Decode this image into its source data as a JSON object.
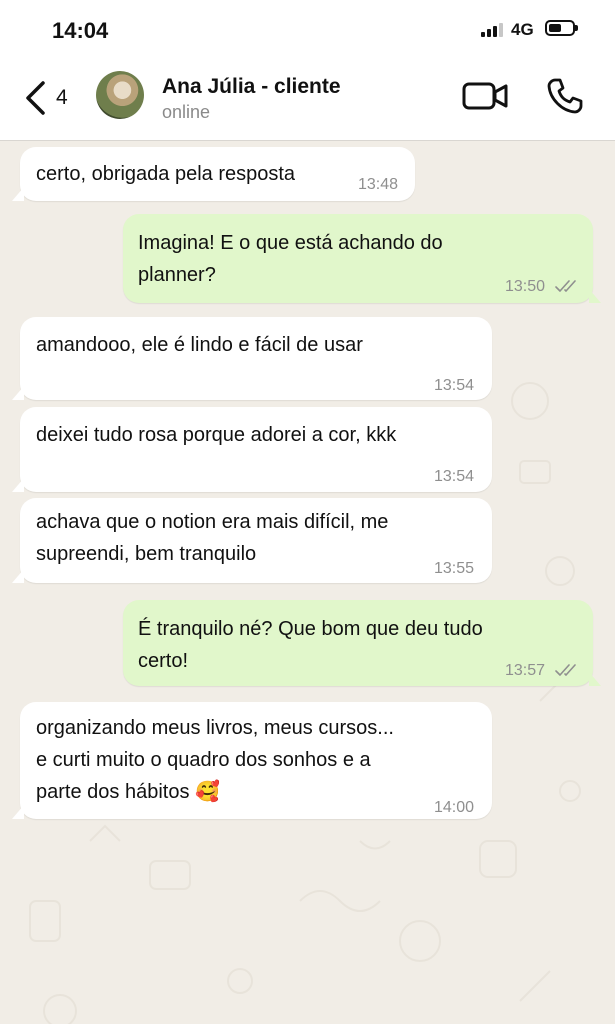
{
  "status_bar": {
    "time": "14:04",
    "network": "4G"
  },
  "header": {
    "back_count": "4",
    "contact_name": "Ana Júlia - cliente",
    "contact_status": "online"
  },
  "messages": [
    {
      "dir": "in",
      "text": "certo, obrigada pela resposta",
      "time": "13:48"
    },
    {
      "dir": "out",
      "text": "Imagina! E o que está achando do\nplanner?",
      "time": "13:50",
      "read": true
    },
    {
      "dir": "in",
      "text": "amandooo, ele é lindo e fácil de usar",
      "time": "13:54"
    },
    {
      "dir": "in",
      "text": "deixei tudo rosa porque adorei a cor, kkk",
      "time": "13:54"
    },
    {
      "dir": "in",
      "text": "achava que o notion era mais difícil, me\nsupreendi, bem tranquilo",
      "time": "13:55"
    },
    {
      "dir": "out",
      "text": "É tranquilo né? Que bom que deu tudo\ncerto!",
      "time": "13:57",
      "read": true
    },
    {
      "dir": "in",
      "text": "organizando meus livros, meus cursos...\ne curti muito o quadro dos sonhos e a\nparte dos hábitos 🥰",
      "time": "14:00"
    }
  ],
  "colors": {
    "incoming_bubble": "#ffffff",
    "outgoing_bubble": "#e1f7cb",
    "chat_background": "#f1ede6",
    "read_ticks": "#8f8f8f"
  },
  "icons": [
    "back-chevron-icon",
    "video-call-icon",
    "phone-icon",
    "double-check-icon",
    "smiling-face-with-hearts-emoji"
  ]
}
